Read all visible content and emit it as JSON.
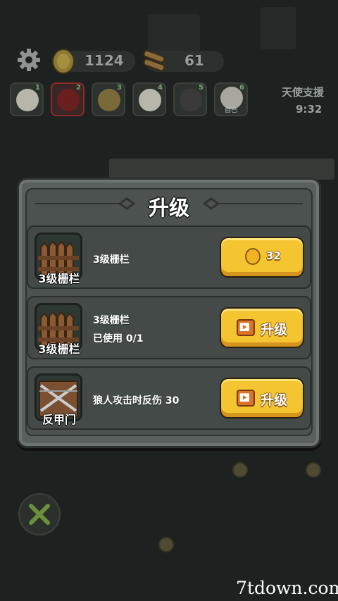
{
  "top_bar": {
    "coins": "1124",
    "wood": "61",
    "angel_support_label": "天使支援",
    "angel_support_time": "9:32",
    "team_slots": [
      {
        "number": "1",
        "label": ""
      },
      {
        "number": "2",
        "label": ""
      },
      {
        "number": "3",
        "label": ""
      },
      {
        "number": "4",
        "label": ""
      },
      {
        "number": "5",
        "label": ""
      },
      {
        "number": "6",
        "label": "自己"
      }
    ]
  },
  "modal": {
    "title": "升级",
    "cards": [
      {
        "item_caption": "3级栅栏",
        "line1": "3级栅栏",
        "line2": "",
        "button_type": "coin",
        "button_label": "32"
      },
      {
        "item_caption": "3级栅栏",
        "line1": "3级栅栏",
        "line2": "已使用 0/1",
        "button_type": "video",
        "button_label": "升级"
      },
      {
        "item_caption": "反甲门",
        "line1": "狼人攻击时反伤 30",
        "line2": "",
        "button_type": "video",
        "button_label": "升级"
      }
    ]
  },
  "watermark": "7tdown.com",
  "colors": {
    "button_yellow": "#f4c531",
    "panel": "#4b524f",
    "background": "#1c1f1e"
  }
}
